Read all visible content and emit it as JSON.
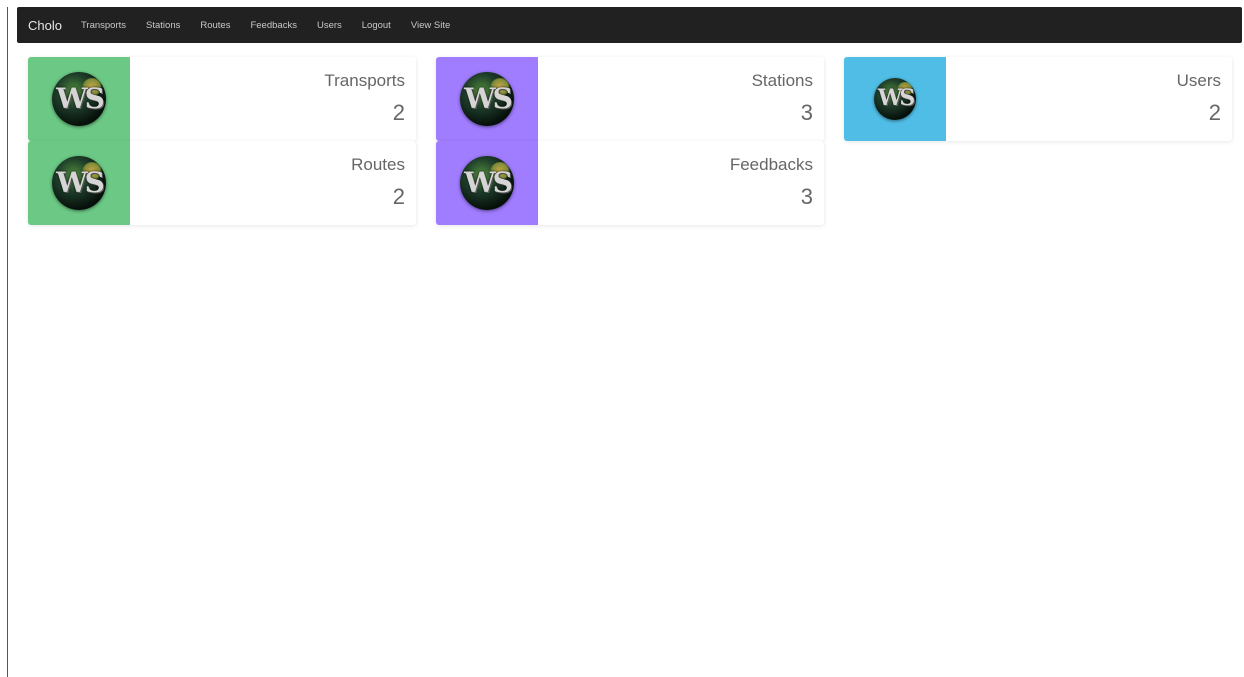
{
  "navbar": {
    "brand": "Cholo",
    "links": [
      {
        "label": "Transports"
      },
      {
        "label": "Stations"
      },
      {
        "label": "Routes"
      },
      {
        "label": "Feedbacks"
      },
      {
        "label": "Users"
      },
      {
        "label": "Logout"
      },
      {
        "label": "View Site"
      }
    ]
  },
  "colors": {
    "navbar_bg": "#212121",
    "green": "#6cc985",
    "purple": "#a07cff",
    "blue": "#50bde6"
  },
  "cards": [
    {
      "title": "Transports",
      "value": "2",
      "color": "#6cc985",
      "icon": "ws-logo-icon"
    },
    {
      "title": "Stations",
      "value": "3",
      "color": "#a07cff",
      "icon": "ws-logo-icon"
    },
    {
      "title": "Users",
      "value": "2",
      "color": "#50bde6",
      "icon": "ws-logo-icon"
    },
    {
      "title": "Routes",
      "value": "2",
      "color": "#6cc985",
      "icon": "ws-logo-icon"
    },
    {
      "title": "Feedbacks",
      "value": "3",
      "color": "#a07cff",
      "icon": "ws-logo-icon"
    }
  ],
  "logo_text": "WS"
}
